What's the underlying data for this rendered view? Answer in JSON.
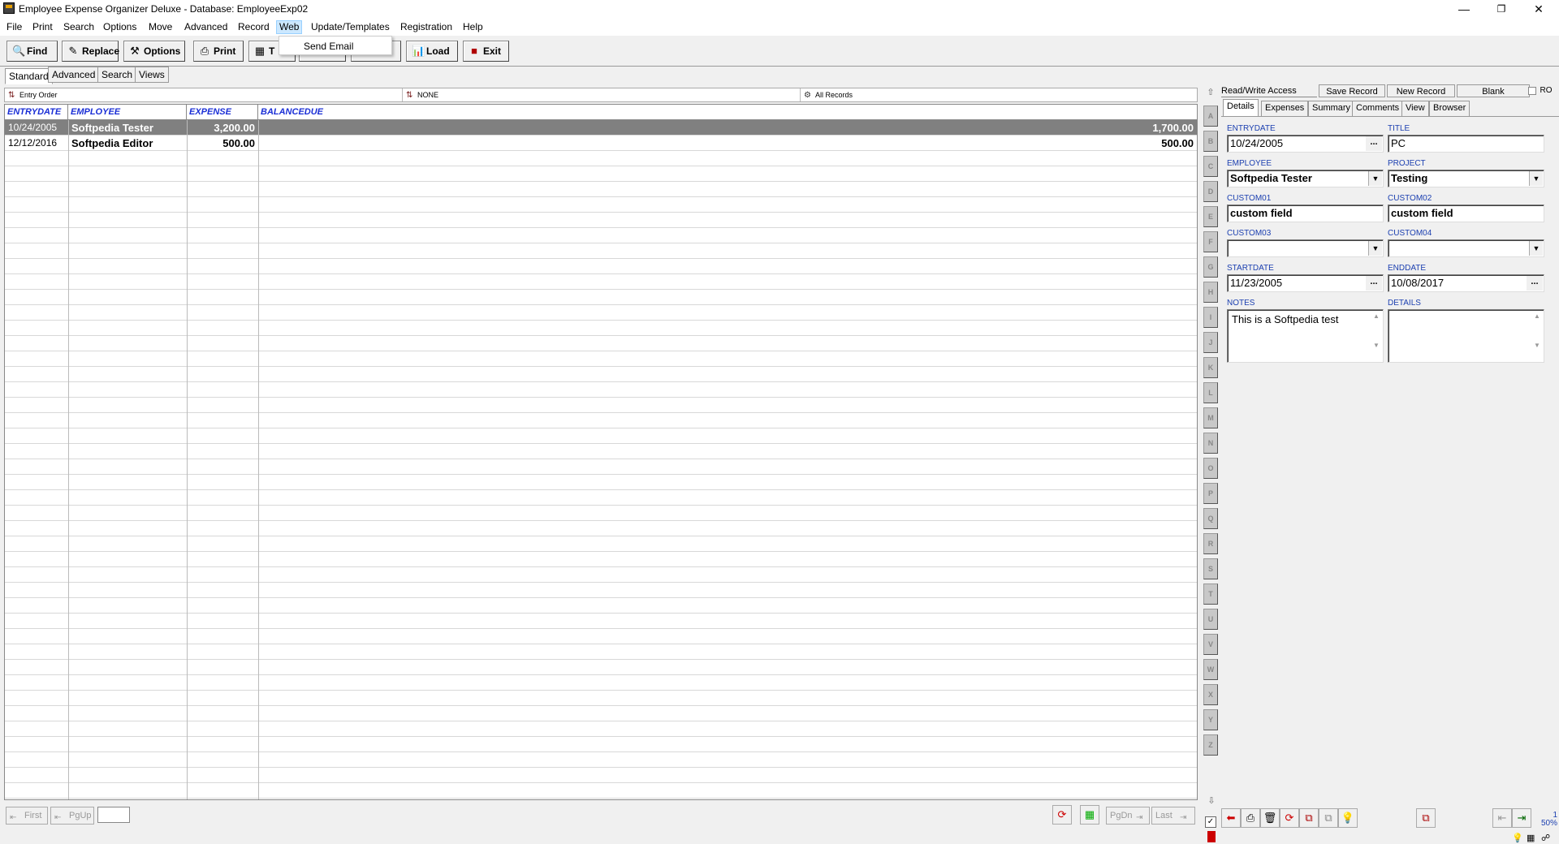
{
  "window": {
    "title": "Employee Expense Organizer Deluxe - Database: EmployeeExp02",
    "minimize": "—",
    "restore": "❐",
    "close": "✕"
  },
  "menu": [
    "File",
    "Print",
    "Search",
    "Options",
    "Move",
    "Advanced",
    "Record",
    "Web",
    "Update/Templates",
    "Registration",
    "Help"
  ],
  "web_menu": {
    "item": "Send Email"
  },
  "toolbar": {
    "find": "Find",
    "replace": "Replace",
    "options": "Options",
    "print": "Print",
    "t_partial": "T",
    "load": "Load",
    "exit": "Exit"
  },
  "subtabs": [
    "Standard",
    "Advanced",
    "Search",
    "Views"
  ],
  "filters": {
    "sort": "Entry Order",
    "group": "NONE",
    "records": "All Records"
  },
  "grid": {
    "columns": [
      "ENTRYDATE",
      "EMPLOYEE",
      "EXPENSE",
      "BALANCEDUE"
    ],
    "rows": [
      {
        "date": "10/24/2005",
        "employee": "Softpedia Tester",
        "expense": "3,200.00",
        "balance": "1,700.00"
      },
      {
        "date": "12/12/2016",
        "employee": "Softpedia Editor",
        "expense": "500.00",
        "balance": "500.00"
      }
    ]
  },
  "letters": [
    "A",
    "B",
    "C",
    "D",
    "E",
    "F",
    "G",
    "H",
    "I",
    "J",
    "K",
    "L",
    "M",
    "N",
    "O",
    "P",
    "Q",
    "R",
    "S",
    "T",
    "U",
    "V",
    "W",
    "X",
    "Y",
    "Z"
  ],
  "right_top": {
    "access": "Read/Write Access",
    "save": "Save Record",
    "new": "New Record",
    "blank": "Blank",
    "ro": "RO"
  },
  "right_tabs": [
    "Details",
    "Expenses",
    "Summary",
    "Comments",
    "View",
    "Browser"
  ],
  "details": {
    "entrydate_label": "ENTRYDATE",
    "entrydate": "10/24/2005",
    "title_label": "TITLE",
    "title": "PC",
    "employee_label": "EMPLOYEE",
    "employee": "Softpedia Tester",
    "project_label": "PROJECT",
    "project": "Testing",
    "custom01_label": "CUSTOM01",
    "custom01": "custom field",
    "custom02_label": "CUSTOM02",
    "custom02": "custom field",
    "custom03_label": "CUSTOM03",
    "custom04_label": "CUSTOM04",
    "startdate_label": "STARTDATE",
    "startdate": "11/23/2005",
    "enddate_label": "ENDDATE",
    "enddate": "10/08/2017",
    "notes_label": "NOTES",
    "notes": "This is a Softpedia test",
    "details_label": "DETAILS"
  },
  "bottom": {
    "first": "First",
    "pgup": "PgUp",
    "pgdn": "PgDn",
    "last": "Last"
  },
  "zoom": {
    "page": "1",
    "percent": "50%"
  }
}
